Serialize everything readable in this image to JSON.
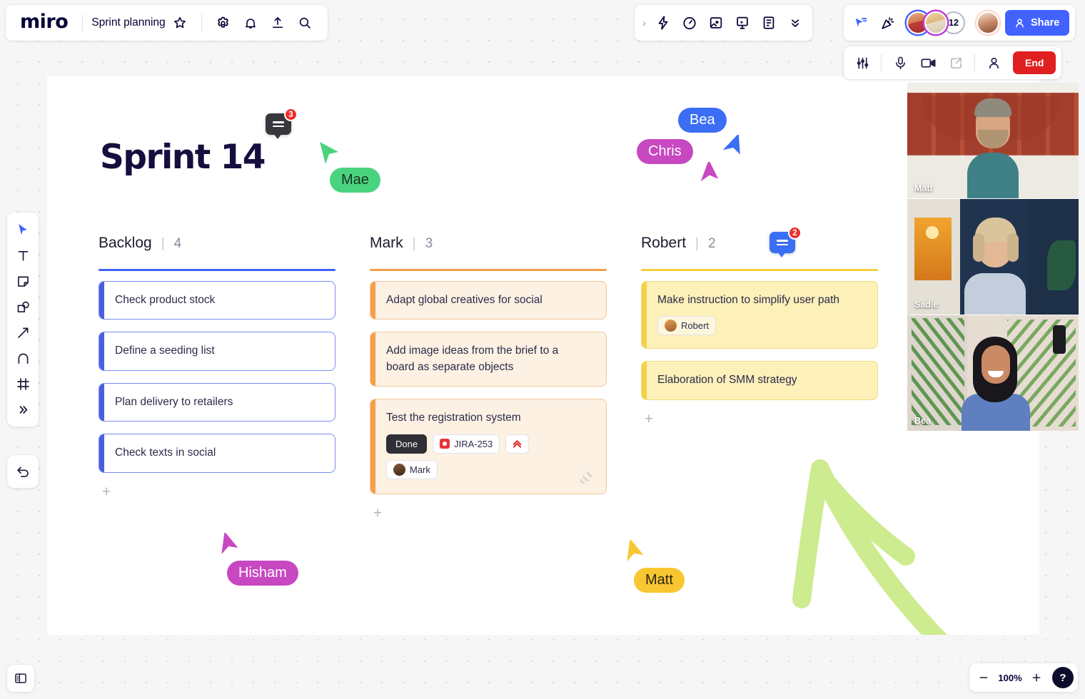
{
  "app": {
    "logo": "miro",
    "board_title": "Sprint planning"
  },
  "header_icons": {
    "star": "star-icon",
    "settings": "gear-icon",
    "notifications": "bell-icon",
    "upload": "upload-icon",
    "search": "search-icon"
  },
  "center_toolbar": {
    "expand": "chevron-right-icon",
    "items": [
      "lightning-icon",
      "timer-icon",
      "frame-media-icon",
      "presentation-icon",
      "document-icon"
    ],
    "more": "chevron-double-down-icon"
  },
  "right_toolbar": {
    "cursor_chat": "cursor-chat-icon",
    "celebrate": "party-popper-icon",
    "overflow_count": "12",
    "share_label": "Share",
    "share_color": "#4262ff"
  },
  "call_bar": {
    "settings": "sliders-icon",
    "mic": "microphone-icon",
    "camera": "video-camera-icon",
    "screen_share": "screen-share-icon",
    "participants": "person-icon",
    "end_label": "End",
    "end_color": "#e02020"
  },
  "video_tiles": [
    {
      "name": "Matt"
    },
    {
      "name": "Sadie"
    },
    {
      "name": "Bea"
    }
  ],
  "tool_rail": {
    "tools": [
      {
        "name": "select-tool",
        "icon": "cursor-arrow-icon",
        "active": true
      },
      {
        "name": "text-tool",
        "icon": "text-icon",
        "active": false
      },
      {
        "name": "sticky-note-tool",
        "icon": "sticky-note-icon",
        "active": false
      },
      {
        "name": "shapes-tool",
        "icon": "shapes-icon",
        "active": false
      },
      {
        "name": "connector-tool",
        "icon": "arrow-icon",
        "active": false
      },
      {
        "name": "pen-tool",
        "icon": "pen-icon",
        "active": false
      },
      {
        "name": "frame-tool",
        "icon": "frame-icon",
        "active": false
      },
      {
        "name": "more-tools",
        "icon": "chevron-double-right-icon",
        "active": false
      }
    ],
    "undo": "undo-icon"
  },
  "bottom": {
    "panel_toggle": "panel-layout-icon",
    "zoom_out": "minus-icon",
    "zoom_level": "100%",
    "zoom_in": "plus-icon",
    "help": "?"
  },
  "board": {
    "title": "Sprint 14",
    "columns": [
      {
        "name": "Backlog",
        "separator": "|",
        "count": "4",
        "rule_color": "#4262ff",
        "accent": "#4a5fe0",
        "card_bg": "#ffffff",
        "card_border": "#7b8bf0",
        "add_label": "+",
        "cards": [
          {
            "text": "Check product stock"
          },
          {
            "text": "Define a seeding list"
          },
          {
            "text": "Plan delivery to retailers"
          },
          {
            "text": "Check texts in social"
          }
        ]
      },
      {
        "name": "Mark",
        "separator": "|",
        "count": "3",
        "rule_color": "#f0a04b",
        "accent": "#f5a04a",
        "card_bg": "#fdf1e3",
        "card_border": "#f3c894",
        "add_label": "+",
        "cards": [
          {
            "text": "Adapt global creatives for social"
          },
          {
            "text": "Add image ideas from the brief to a board as separate objects"
          },
          {
            "text": "Test the registration system",
            "status_chip": "Done",
            "jira_chip": "JIRA-253",
            "priority_icon": "priority-highest-icon",
            "assignee_chip": "Mark",
            "watermark": "jira-logo-icon"
          }
        ]
      },
      {
        "name": "Robert",
        "separator": "|",
        "count": "2",
        "rule_color": "#f2cf3b",
        "accent": "#f4d14a",
        "card_bg": "#fdf0b9",
        "card_border": "#f2dc82",
        "add_label": "+",
        "cards": [
          {
            "text": "Make instruction to simplify user path",
            "assignee_chip": "Robert"
          },
          {
            "text": "Elaboration of SMM strategy"
          }
        ]
      }
    ],
    "comment_pins": [
      {
        "name": "title-comment-pin",
        "count": "3",
        "color": "#37373d"
      },
      {
        "name": "robert-column-comment-pin",
        "count": "2",
        "color": "#3b6ef5"
      }
    ],
    "cursors": [
      {
        "name": "Mae",
        "color": "#4ad37f",
        "text_color": "#14331f"
      },
      {
        "name": "Chris",
        "color": "#c748c0",
        "text_color": "#ffffff"
      },
      {
        "name": "Bea",
        "color": "#3b6ef5",
        "text_color": "#ffffff"
      },
      {
        "name": "Hisham",
        "color": "#c748c0",
        "text_color": "#ffffff"
      },
      {
        "name": "Matt",
        "color": "#f8c630",
        "text_color": "#2b2310"
      }
    ],
    "drawn_arrow": {
      "name": "green-hand-drawn-arrow",
      "color": "#cdeb8f"
    }
  }
}
